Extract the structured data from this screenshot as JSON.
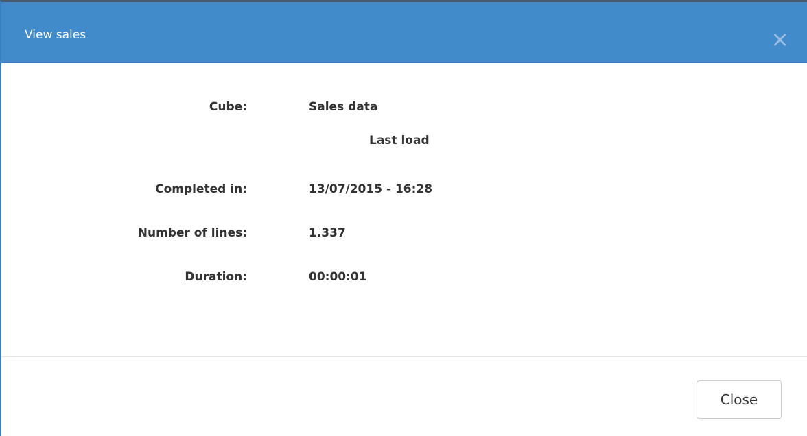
{
  "dialog": {
    "title": "View sales",
    "close_icon": "×"
  },
  "details": {
    "cube_label": "Cube:",
    "cube_value": "Sales data",
    "section_heading": "Last load",
    "completed_label": "Completed in:",
    "completed_value": "13/07/2015 - 16:28",
    "lines_label": "Number of lines:",
    "lines_value": "1.337",
    "duration_label": "Duration:",
    "duration_value": "00:00:01"
  },
  "footer": {
    "close_label": "Close"
  },
  "colors": {
    "header_bg": "#428bca",
    "header_text": "#ffffff"
  }
}
